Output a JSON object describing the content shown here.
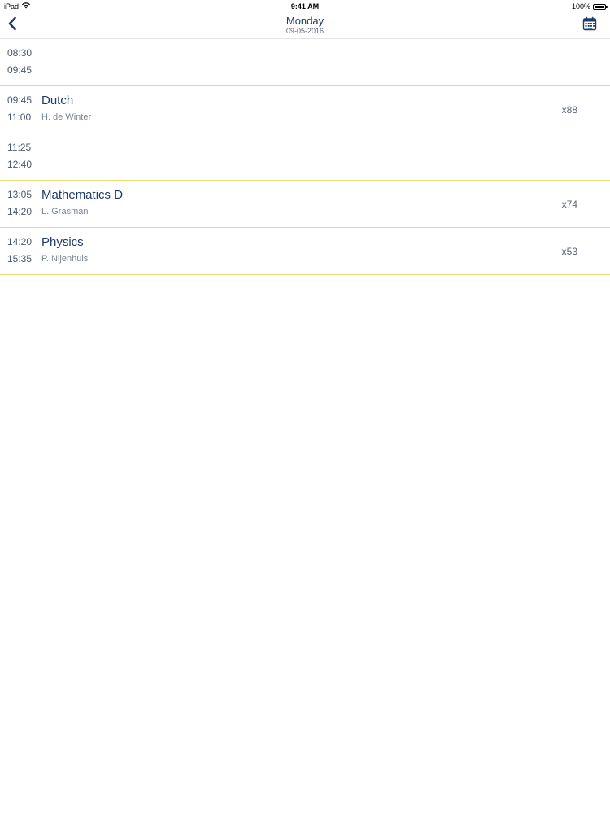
{
  "status_bar": {
    "device": "iPad",
    "time": "9:41 AM",
    "battery": "100%",
    "battery_level": 1.0
  },
  "nav": {
    "title": "Monday",
    "date": "09-05-2016",
    "back_icon": "chevron-left-icon",
    "calendar_icon": "calendar-icon"
  },
  "colors": {
    "accent": "#1f3a6b",
    "divider": "#f2dc74"
  },
  "schedule": [
    {
      "start": "08:30",
      "end": "09:45",
      "subject": "",
      "teacher": "",
      "room": ""
    },
    {
      "start": "09:45",
      "end": "11:00",
      "subject": "Dutch",
      "teacher": "H. de Winter",
      "room": "x88"
    },
    {
      "start": "11:25",
      "end": "12:40",
      "subject": "",
      "teacher": "",
      "room": ""
    },
    {
      "start": "13:05",
      "end": "14:20",
      "subject": "Mathematics D",
      "teacher": "L. Grasman",
      "room": "x74"
    },
    {
      "start": "14:20",
      "end": "15:35",
      "subject": "Physics",
      "teacher": "P. Nijenhuis",
      "room": "x53"
    }
  ]
}
